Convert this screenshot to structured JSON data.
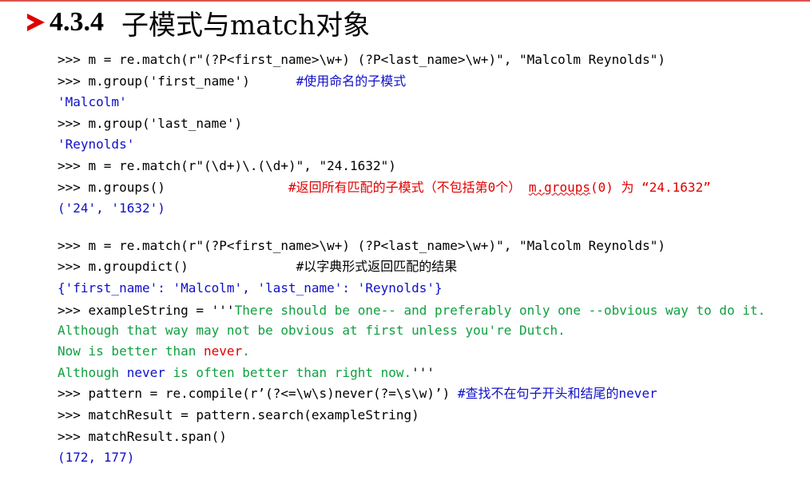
{
  "heading": {
    "number": "4.3.4",
    "title": "子模式与match对象"
  },
  "code": {
    "l1": ">>> m = re.match(r\"(?P<first_name>\\w+) (?P<last_name>\\w+)\", \"Malcolm Reynolds\")",
    "l2_code": ">>> m.group('first_name')      ",
    "l2_comment": "#使用命名的子模式",
    "l3_out": "'Malcolm'",
    "l4": ">>> m.group('last_name')",
    "l5_out": "'Reynolds'",
    "l6": ">>> m = re.match(r\"(\\d+)\\.(\\d+)\", \"24.1632\")",
    "l7_code": ">>> m.groups()                ",
    "l7_comment_red": "#返回所有匹配的子模式（不包括第0个）",
    "l7_groups_call": "m.groups",
    "l7_tail": "(0) 为 “24.1632”",
    "l8_out": "('24', '1632')",
    "l9": ">>> m = re.match(r\"(?P<first_name>\\w+) (?P<last_name>\\w+)\", \"Malcolm Reynolds\")",
    "l10_code": ">>> m.groupdict()              ",
    "l10_comment": "#以字典形式返回匹配的结果",
    "l11_out": "{'first_name': 'Malcolm', 'last_name': 'Reynolds'}",
    "l12_prefix": ">>> exampleString = '''",
    "l12_str": "There should be one-- and preferably only one --obvious way to do it.",
    "l13_str": "Although that way may not be obvious at first unless you're Dutch.",
    "l14_a": "Now is better than ",
    "l14_never": "never",
    "l14_b": ".",
    "l15_a": "Although ",
    "l15_never": "never",
    "l15_b": " is often better than right now.",
    "l15_end": "'''",
    "l16_code": ">>> pattern = re.compile(r’(?<=\\w\\s)never(?=\\s\\w)’) ",
    "l16_comment": "#查找不在句子开头和结尾的never",
    "l17": ">>> matchResult = pattern.search(exampleString)",
    "l18": ">>> matchResult.span()",
    "l19_out": "(172, 177)"
  }
}
